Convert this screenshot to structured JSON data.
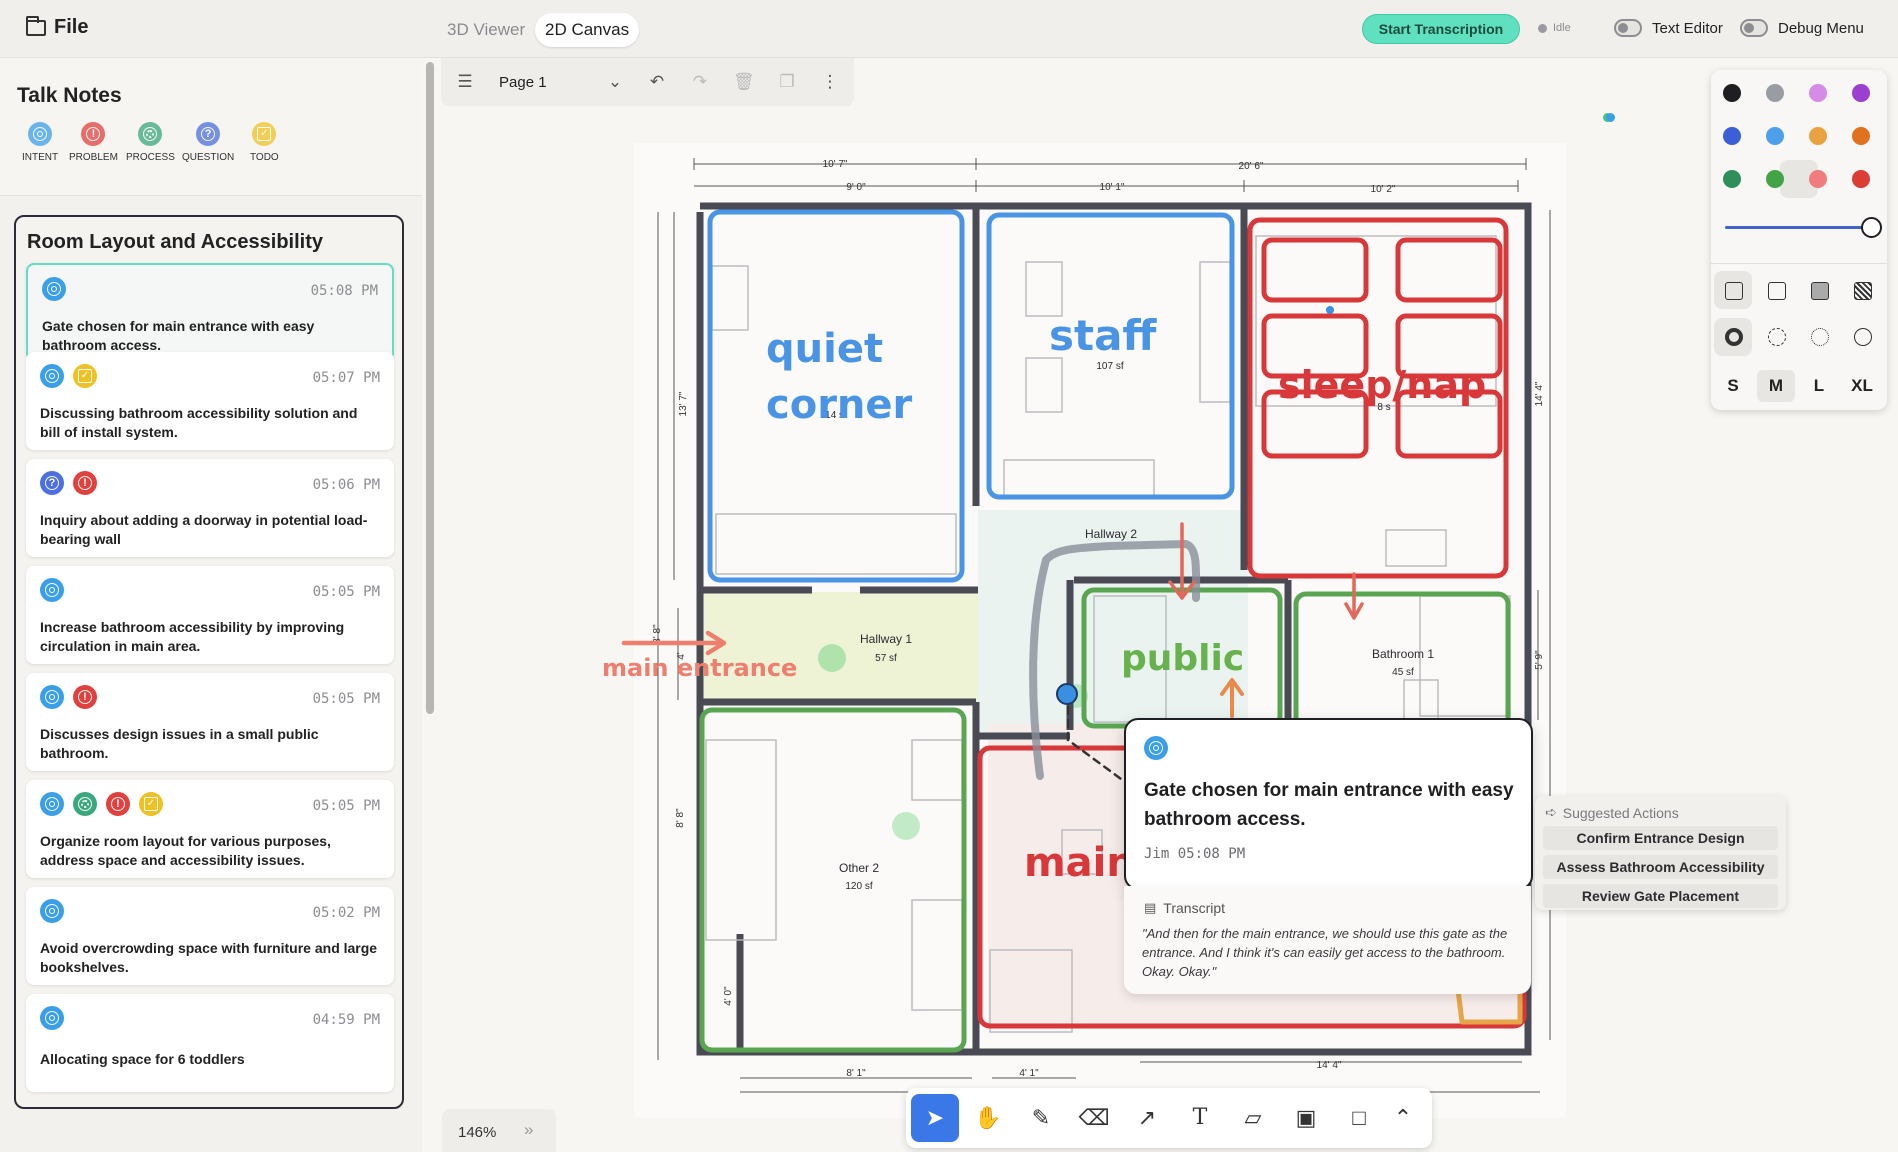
{
  "topbar": {
    "file_label": "File",
    "tabs": [
      {
        "label": "3D Viewer",
        "active": false
      },
      {
        "label": "2D Canvas",
        "active": true
      }
    ],
    "start_button": "Start Transcription",
    "status": "Idle",
    "toggles": [
      {
        "label": "Text Editor"
      },
      {
        "label": "Debug Menu"
      }
    ]
  },
  "sidebar": {
    "title": "Talk Notes",
    "legend": [
      {
        "icon": "intent-icon",
        "label": "INTENT"
      },
      {
        "icon": "problem-icon",
        "label": "PROBLEM"
      },
      {
        "icon": "process-icon",
        "label": "PROCESS"
      },
      {
        "icon": "question-icon",
        "label": "QUESTION"
      },
      {
        "icon": "todo-icon",
        "label": "TODO"
      }
    ]
  },
  "group": {
    "title": "Room Layout and Accessibility",
    "notes": [
      {
        "time": "05:08 PM",
        "text": "Gate chosen for main entrance with easy bathroom access.",
        "tags": [
          "intent"
        ],
        "selected": true
      },
      {
        "time": "05:07 PM",
        "text": "Discussing bathroom accessibility solution and bill of install system.",
        "tags": [
          "intent",
          "todo"
        ]
      },
      {
        "time": "05:06 PM",
        "text": "Inquiry about adding a doorway in potential load-bearing wall",
        "tags": [
          "question",
          "problem"
        ]
      },
      {
        "time": "05:05 PM",
        "text": "Increase bathroom accessibility by improving circulation in main area.",
        "tags": [
          "intent"
        ]
      },
      {
        "time": "05:05 PM",
        "text": "Discusses design issues in a small public bathroom.",
        "tags": [
          "intent",
          "problem"
        ]
      },
      {
        "time": "05:05 PM",
        "text": "Organize room layout for various purposes, address space and accessibility issues.",
        "tags": [
          "intent",
          "process",
          "problem",
          "todo"
        ]
      },
      {
        "time": "05:02 PM",
        "text": "Avoid overcrowding space with furniture and large bookshelves.",
        "tags": [
          "intent"
        ]
      },
      {
        "time": "04:59 PM",
        "text": "Allocating space for 6 toddlers",
        "tags": [
          "intent"
        ]
      }
    ]
  },
  "canvas": {
    "page_label": "Page 1",
    "zoom": "146%"
  },
  "plan": {
    "dims_top": [
      "10' 7\"",
      "20' 6\"",
      "9' 0\"",
      "10' 1\"",
      "10' 2\""
    ],
    "dims_side": [
      "13' 7\"",
      "14' 4\"",
      "3' 8\"",
      "4'",
      "8' 8\"",
      "5' 9\"",
      "4' 0\""
    ],
    "dims_bottom": [
      "8' 1\"",
      "4' 1\"",
      "14' 4\""
    ],
    "rooms": [
      {
        "name": "Hallway 2"
      },
      {
        "name": "Hallway 1",
        "area": "57 sf"
      },
      {
        "name": "Bathroom 1",
        "area": "45 sf"
      },
      {
        "name": "Other 2",
        "area": "120 sf"
      },
      {
        "name": "",
        "area": "107 sf"
      },
      {
        "name": "",
        "area": "14 sf"
      },
      {
        "name": "",
        "area": "8 s"
      }
    ],
    "annotations": [
      "quiet",
      "corner",
      "staff",
      "sleep/nap",
      "public",
      "main entrance",
      "main"
    ]
  },
  "popover": {
    "title": "Gate chosen for main entrance with easy bathroom access.",
    "meta": "Jim 05:08 PM",
    "transcript_label": "Transcript",
    "transcript": "\"And then for the main entrance, we should use this gate as the entrance. And I think it's can easily get access to the bathroom. Okay. Okay.\""
  },
  "suggested": {
    "title": "Suggested Actions",
    "actions": [
      "Confirm Entrance Design",
      "Assess Bathroom Accessibility",
      "Review Gate Placement"
    ]
  },
  "style_panel": {
    "colors": [
      "#1f1f22",
      "#9a9ca3",
      "#d68be6",
      "#9a3fd0",
      "#3a5fd8",
      "#4c9fe8",
      "#e8a340",
      "#e0711f",
      "#2f8f5b",
      "#43a347",
      "#f07c7c",
      "#db3c35"
    ],
    "sizes": [
      "S",
      "M",
      "L",
      "XL"
    ],
    "selected_size": "M",
    "selected_color": "#f07c7c"
  },
  "toolbar": {
    "tools": [
      "select-icon",
      "hand-icon",
      "pencil-icon",
      "eraser-icon",
      "arrow-icon",
      "text-icon",
      "note-icon",
      "image-icon",
      "rectangle-icon",
      "chevron-up-icon"
    ],
    "selected": "select-icon"
  }
}
